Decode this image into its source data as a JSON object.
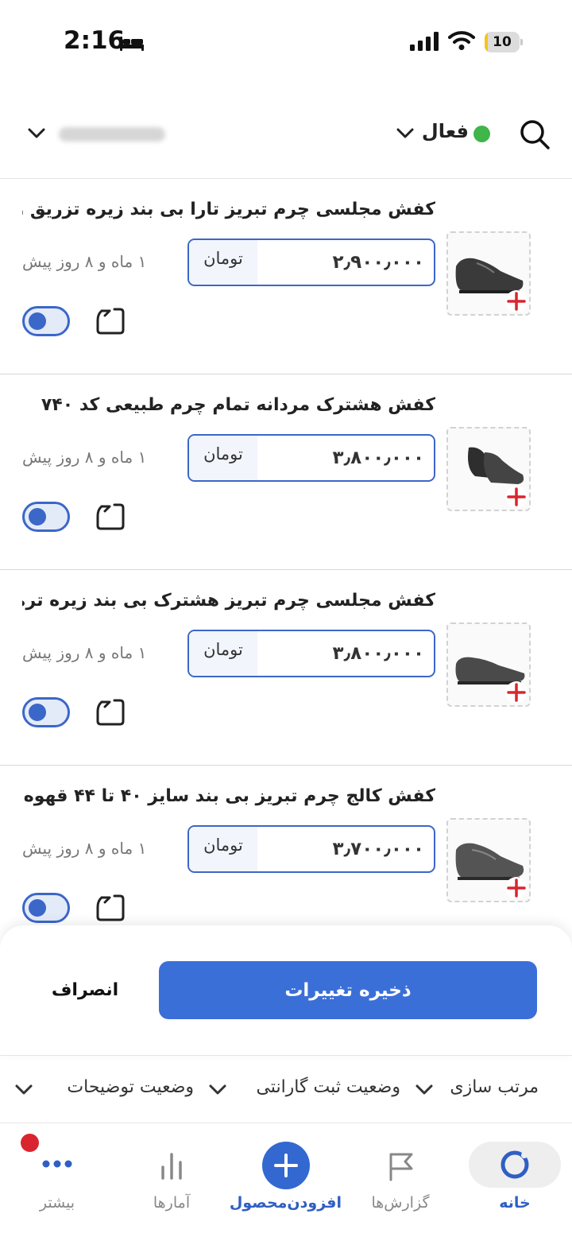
{
  "status_bar": {
    "time": "2:16",
    "battery": "10",
    "battery_level": 0.1
  },
  "filters": {
    "status_label": "فعال",
    "status_color": "#3fb54a"
  },
  "products": [
    {
      "title": "کفش مجلسی چرم تبریز تارا بی بند زیره تزریق رنگ...",
      "price": "۲٫۹۰۰٫۰۰۰",
      "currency": "تومان",
      "date": "۱ ماه و ۸ روز پیش",
      "active": true
    },
    {
      "title": "کفش هشترک مردانه تمام چرم طبیعی کد ۷۴۰",
      "price": "۳٫۸۰۰٫۰۰۰",
      "currency": "تومان",
      "date": "۱ ماه و ۸ روز پیش",
      "active": true
    },
    {
      "title": "کفش مجلسی چرم تبریز هشترک بی بند زیره ترمو",
      "price": "۳٫۸۰۰٫۰۰۰",
      "currency": "تومان",
      "date": "۱ ماه و ۸ روز پیش",
      "active": true
    },
    {
      "title": "کفش کالج چرم تبریز بی بند سایز ۴۰ تا ۴۴ قهوه ا...",
      "price": "۳٫۷۰۰٫۰۰۰",
      "currency": "تومان",
      "date": "۱ ماه و ۸ روز پیش",
      "active": true
    }
  ],
  "actions": {
    "save": "ذخیره تغییرات",
    "cancel": "انصراف"
  },
  "sort": {
    "sort_by": "مرتب سازی",
    "warranty_status": "وضعیت ثبت گارانتی",
    "description_status": "وضعیت توضیحات"
  },
  "nav": {
    "home": "خانه",
    "reports": "گزارش‌ها",
    "add_product": "افزودن‌محصول",
    "stats": "آمارها",
    "more": "بیشتر"
  },
  "colors": {
    "accent": "#3b6fd8",
    "active_nav": "#2f5fc4",
    "badge": "#d9252f",
    "add_icon": "#d9252f"
  }
}
